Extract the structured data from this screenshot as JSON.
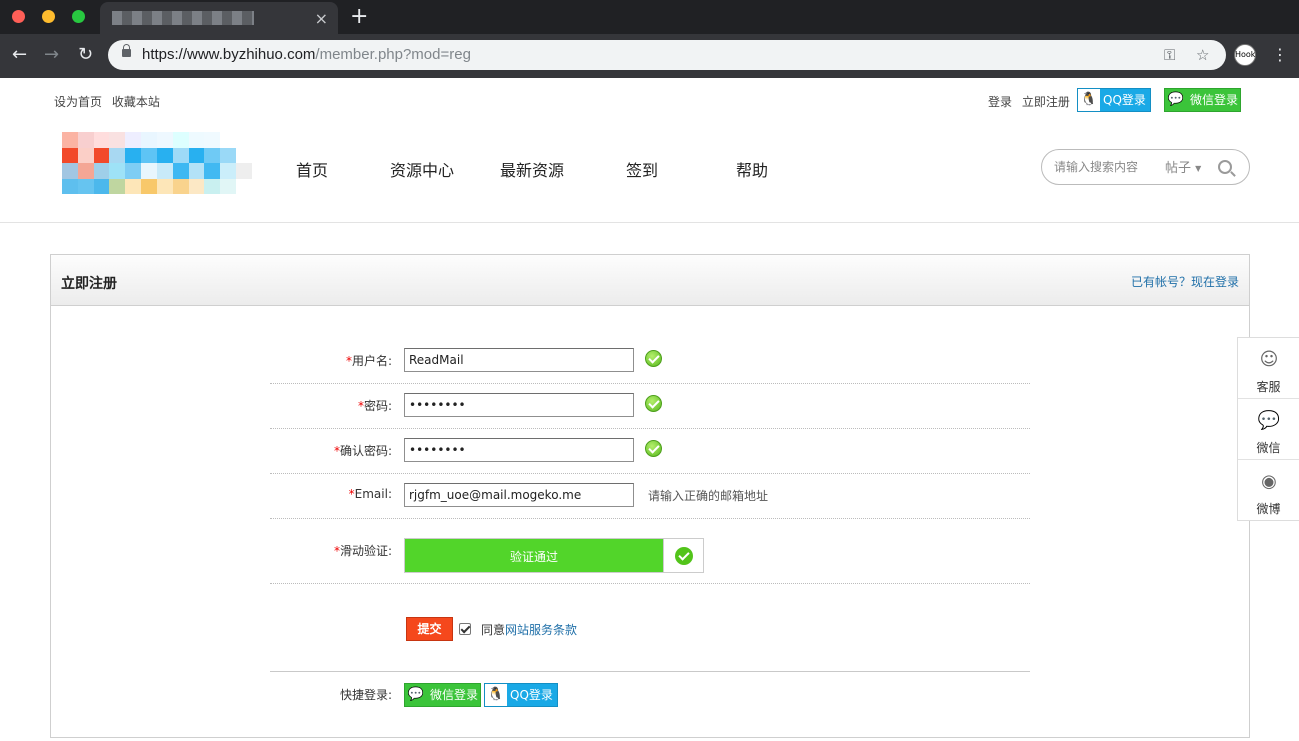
{
  "browser": {
    "url_host": "https://www.byzhihuo.com",
    "url_path": "/member.php?mod=reg",
    "tab_close": "×",
    "new_tab": "+",
    "avatar_text": "Hook"
  },
  "toplinks": {
    "set_home": "设为首页",
    "bookmark": "收藏本站",
    "login": "登录",
    "register": "立即注册",
    "qq_login": "QQ登录",
    "wechat_login": "微信登录"
  },
  "nav": [
    "首页",
    "资源中心",
    "最新资源",
    "签到",
    "帮助"
  ],
  "search": {
    "placeholder": "请输入搜索内容",
    "type": "帖子"
  },
  "panel": {
    "title": "立即注册",
    "login_link": "已有帐号？现在登录"
  },
  "form": {
    "username_label": "用户名:",
    "username_value": "ReadMail",
    "password_label": "密码:",
    "password_value": "••••••••",
    "confirm_label": "确认密码:",
    "confirm_value": "••••••••",
    "email_label": "Email:",
    "email_value": "rjgfm_uoe@mail.mogeko.me",
    "email_hint": "请输入正确的邮箱地址",
    "slider_label": "滑动验证:",
    "slider_text": "验证通过",
    "submit_label": "提交",
    "agree_prefix": "同意",
    "agree_link": "网站服务条款",
    "quick_label": "快捷登录:",
    "quick_wechat": "微信登录",
    "quick_qq": "QQ登录",
    "required_mark": "*"
  },
  "float_bar": [
    {
      "label": "客服",
      "icon": "headset-icon"
    },
    {
      "label": "微信",
      "icon": "wechat-icon"
    },
    {
      "label": "微博",
      "icon": "weibo-icon"
    }
  ],
  "colors": {
    "accent_link": "#1f6fa8",
    "submit": "#f5481c",
    "slider_ok": "#52d52a",
    "qq": "#1aa9e6",
    "wechat": "#3bc43a"
  }
}
